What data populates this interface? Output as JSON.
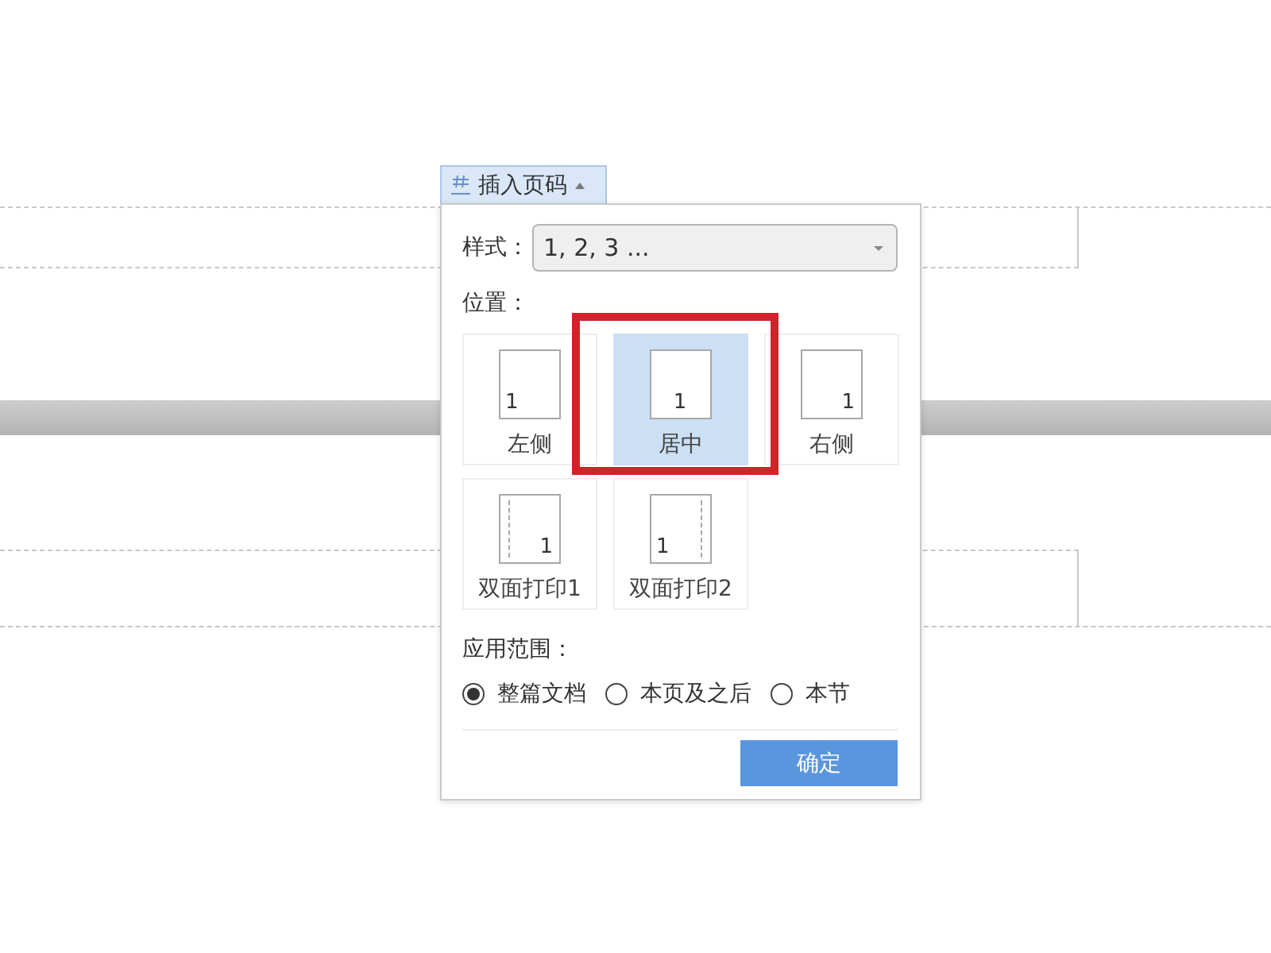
{
  "toolbar_button": {
    "label": "插入页码",
    "expanded": true
  },
  "style": {
    "label": "样式：",
    "value": "1, 2, 3 ..."
  },
  "position": {
    "label": "位置：",
    "options": [
      {
        "kind": "left",
        "page_number": "1",
        "label": "左侧",
        "selected": false,
        "highlighted": false
      },
      {
        "kind": "center",
        "page_number": "1",
        "label": "居中",
        "selected": true,
        "highlighted": true
      },
      {
        "kind": "right",
        "page_number": "1",
        "label": "右侧",
        "selected": false,
        "highlighted": false
      },
      {
        "kind": "duplex1",
        "page_number": "1",
        "label": "双面打印1",
        "selected": false,
        "highlighted": false
      },
      {
        "kind": "duplex2",
        "page_number": "1",
        "label": "双面打印2",
        "selected": false,
        "highlighted": false
      }
    ]
  },
  "scope": {
    "label": "应用范围：",
    "options": [
      {
        "label": "整篇文档",
        "selected": true
      },
      {
        "label": "本页及之后",
        "selected": false
      },
      {
        "label": "本节",
        "selected": false
      }
    ]
  },
  "confirm_button": {
    "label": "确定"
  }
}
